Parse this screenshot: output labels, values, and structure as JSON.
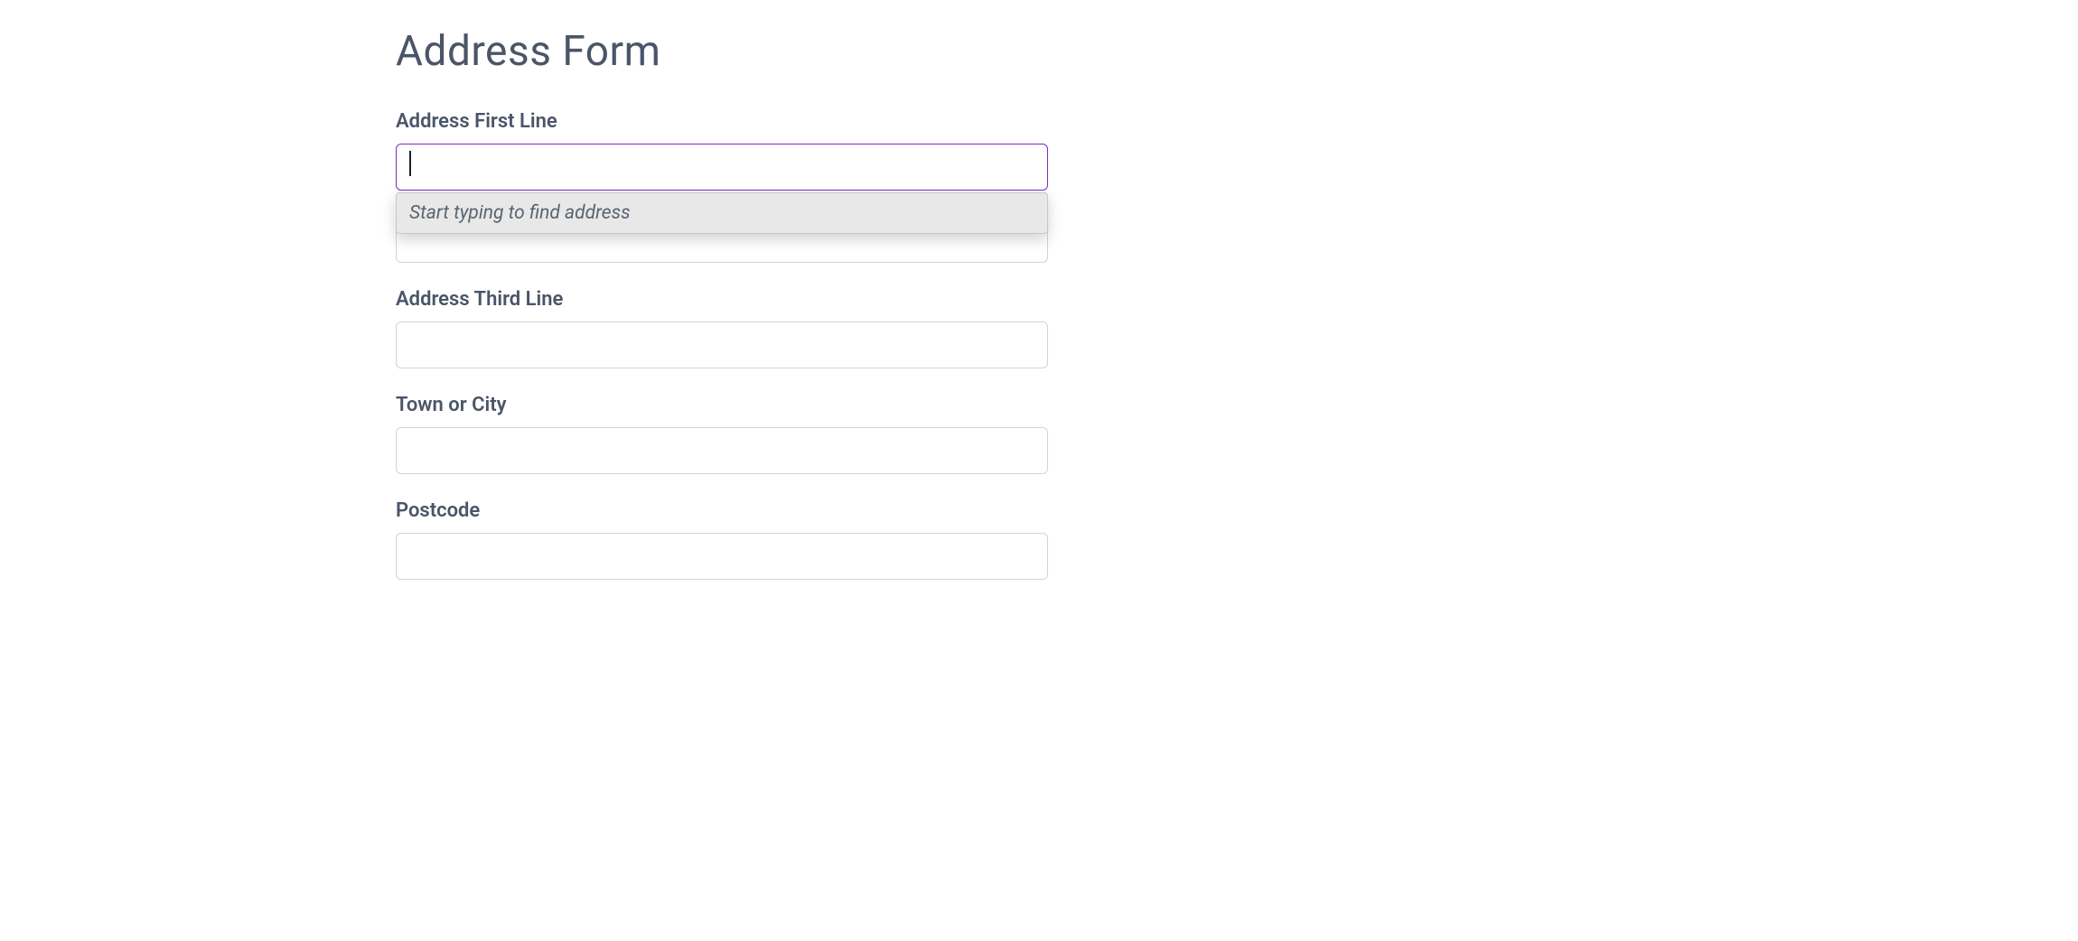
{
  "form": {
    "title": "Address Form",
    "fields": {
      "line1": {
        "label": "Address First Line",
        "value": ""
      },
      "line2": {
        "value": ""
      },
      "line3": {
        "label": "Address Third Line",
        "value": ""
      },
      "town": {
        "label": "Town or City",
        "value": ""
      },
      "postcode": {
        "label": "Postcode",
        "value": ""
      }
    },
    "autocomplete": {
      "hint": "Start typing to find address"
    }
  }
}
